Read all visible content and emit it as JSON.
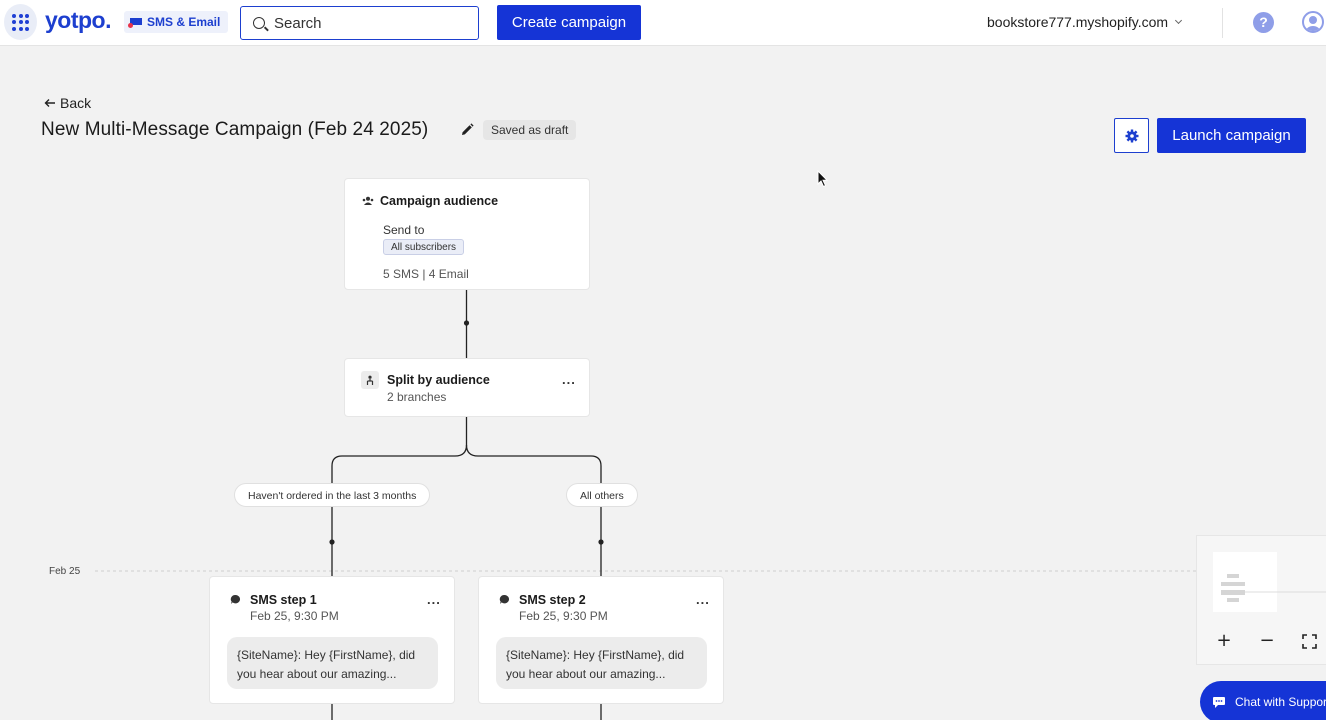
{
  "topbar": {
    "logo": "yotpo.",
    "product": "SMS & Email",
    "search_placeholder": "Search",
    "create_label": "Create campaign",
    "store": "bookstore777.myshopify.com",
    "help_glyph": "?"
  },
  "header": {
    "back_label": "Back",
    "title": "New Multi-Message Campaign (Feb 24 2025)",
    "status": "Saved as draft",
    "launch_label": "Launch campaign"
  },
  "audience": {
    "title": "Campaign audience",
    "send_to_label": "Send to",
    "segment": "All subscribers",
    "counts": "5 SMS | 4 Email"
  },
  "split": {
    "title": "Split by audience",
    "subtitle": "2 branches",
    "menu": "..."
  },
  "branches": [
    {
      "label": "Haven't ordered in the last 3 months"
    },
    {
      "label": "All others"
    }
  ],
  "timeline": {
    "date": "Feb 25"
  },
  "steps": [
    {
      "title": "SMS step 1",
      "time": "Feb 25, 9:30 PM",
      "message": "{SiteName}: Hey {FirstName}, did you hear about our amazing...",
      "menu": "..."
    },
    {
      "title": "SMS step 2",
      "time": "Feb 25, 9:30 PM",
      "message": "{SiteName}: Hey {FirstName}, did you hear about our amazing...",
      "menu": "..."
    }
  ],
  "zoom": {
    "in": "+",
    "out": "−"
  },
  "chat": {
    "label": "Chat with Support"
  },
  "colors": {
    "brand": "#1534d6",
    "accent": "#1d3fcf"
  },
  "icons": [
    "apps-grid-icon",
    "product-logo-icon",
    "search-icon",
    "chevron-down-icon",
    "help-icon",
    "user-icon",
    "arrow-left-icon",
    "pencil-icon",
    "gear-icon",
    "audience-icon",
    "split-icon",
    "sms-icon",
    "fullscreen-icon",
    "chat-icon",
    "cursor-icon"
  ]
}
